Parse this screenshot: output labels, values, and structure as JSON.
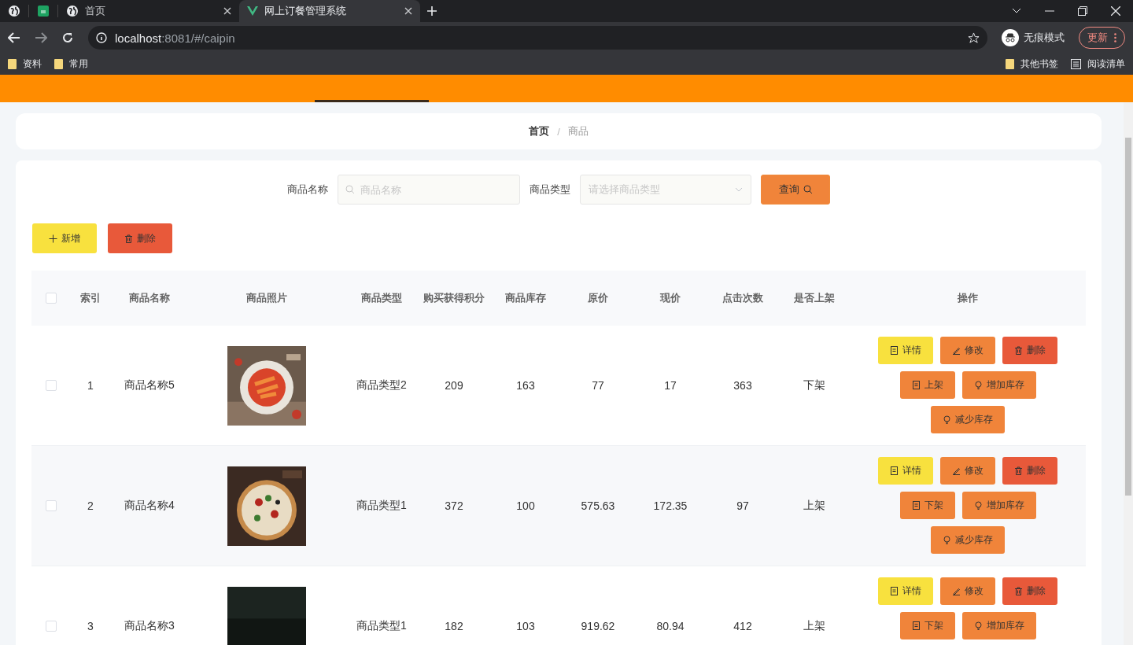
{
  "browser": {
    "tabs": [
      {
        "title": "首页",
        "selected": false
      },
      {
        "title": "网上订餐管理系统",
        "selected": true
      }
    ],
    "address": {
      "host": "localhost",
      "path": ":8081/#/caipin"
    },
    "profile": "无痕模式",
    "update": "更新",
    "bookmarks": [
      "资料",
      "常用"
    ],
    "bookmarks_right": [
      "其他书签",
      "阅读清单"
    ]
  },
  "breadcrumb": {
    "items": [
      "首页",
      "商品"
    ],
    "separator": "/"
  },
  "search": {
    "fields": [
      {
        "kind": "input",
        "label": "商品名称",
        "placeholder": "商品名称"
      },
      {
        "kind": "select",
        "label": "商品类型",
        "placeholder": "请选择商品类型"
      }
    ],
    "button": "查询"
  },
  "actions": [
    {
      "kind": "add",
      "label": "新增"
    },
    {
      "kind": "delete",
      "label": "删除"
    }
  ],
  "table": {
    "all_checked": false,
    "columns": [
      "索引",
      "商品名称",
      "商品照片",
      "商品类型",
      "购买获得积分",
      "商品库存",
      "原价",
      "现价",
      "点击次数",
      "是否上架",
      "操作"
    ],
    "rows": [
      {
        "checked": false,
        "index": "1",
        "name": "商品名称5",
        "type": "商品类型2",
        "points": "209",
        "stock": "163",
        "price": "77",
        "current": "17",
        "clicks": "363",
        "status": "下架",
        "buttons": [
          {
            "kind": "detail",
            "label": "详情"
          },
          {
            "kind": "edit",
            "label": "修改"
          },
          {
            "kind": "delete",
            "label": "删除"
          },
          {
            "kind": "shelf",
            "label": "上架"
          },
          {
            "kind": "stock",
            "label": "增加库存"
          },
          {
            "kind": "stock",
            "label": "减少库存"
          }
        ]
      },
      {
        "checked": false,
        "index": "2",
        "name": "商品名称4",
        "type": "商品类型1",
        "points": "372",
        "stock": "100",
        "price": "575.63",
        "current": "172.35",
        "clicks": "97",
        "status": "上架",
        "buttons": [
          {
            "kind": "detail",
            "label": "详情"
          },
          {
            "kind": "edit",
            "label": "修改"
          },
          {
            "kind": "delete",
            "label": "删除"
          },
          {
            "kind": "shelf",
            "label": "下架"
          },
          {
            "kind": "stock",
            "label": "增加库存"
          },
          {
            "kind": "stock",
            "label": "减少库存"
          }
        ]
      },
      {
        "checked": false,
        "index": "3",
        "name": "商品名称3",
        "type": "商品类型1",
        "points": "182",
        "stock": "103",
        "price": "919.62",
        "current": "80.94",
        "clicks": "412",
        "status": "上架",
        "buttons": [
          {
            "kind": "detail",
            "label": "详情"
          },
          {
            "kind": "edit",
            "label": "修改"
          },
          {
            "kind": "delete",
            "label": "删除"
          },
          {
            "kind": "shelf",
            "label": "下架"
          },
          {
            "kind": "stock",
            "label": "增加库存"
          }
        ]
      }
    ]
  }
}
